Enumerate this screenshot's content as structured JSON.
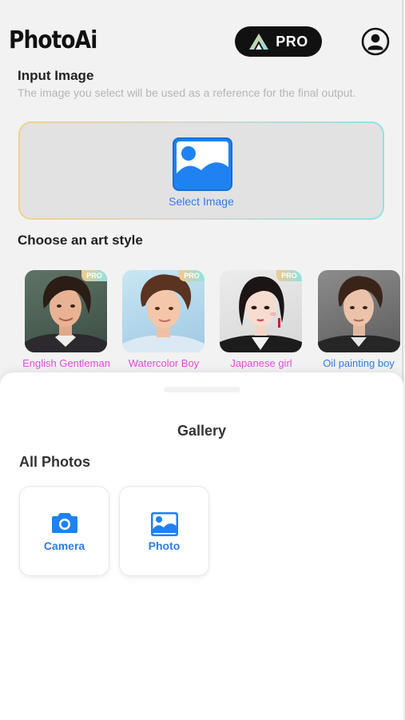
{
  "header": {
    "app_name": "PhotoAi",
    "pro_label": "PRO"
  },
  "input_section": {
    "title": "Input Image",
    "description": "The image you select will be used as a reference for the final output.",
    "select_label": "Select Image"
  },
  "style_section": {
    "title": "Choose an art style",
    "styles": [
      {
        "label": "English Gentleman",
        "pro": "PRO",
        "label_color": "#e04bd8"
      },
      {
        "label": "Watercolor Boy",
        "pro": "PRO",
        "label_color": "#e04bd8"
      },
      {
        "label": "Japanese girl",
        "pro": "PRO",
        "label_color": "#e04bd8"
      },
      {
        "label": "Oil painting boy",
        "pro": "",
        "label_color": "#2f7de1"
      }
    ]
  },
  "gallery_sheet": {
    "title": "Gallery",
    "section_title": "All Photos",
    "tiles": [
      {
        "label": "Camera",
        "icon": "camera-icon"
      },
      {
        "label": "Photo",
        "icon": "image-icon"
      }
    ]
  },
  "colors": {
    "accent": "#2f7de1",
    "pro_pill": "#111111",
    "style_label_pro": "#e04bd8"
  }
}
